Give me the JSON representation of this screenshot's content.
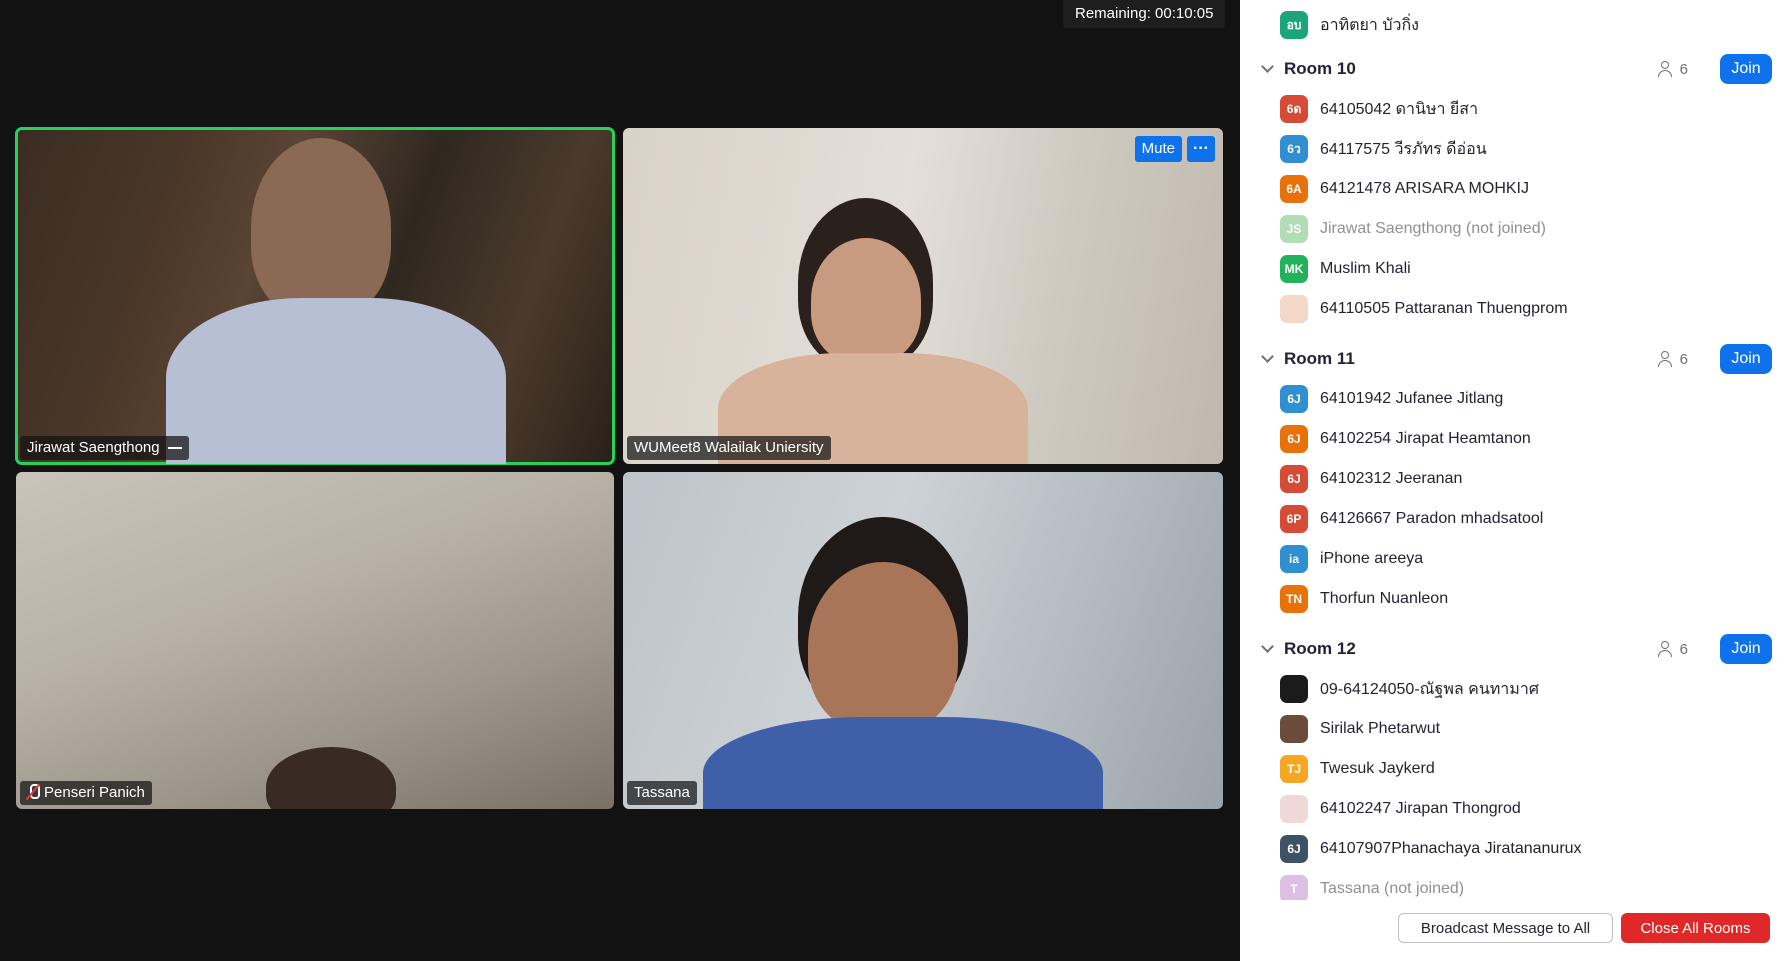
{
  "meeting": {
    "remaining": "Remaining: 00:10:05"
  },
  "videos": [
    {
      "name": "Jirawat Saengthong",
      "speaking": true
    },
    {
      "name": "WUMeet8 Walailak Uniersity",
      "mute_label": "Mute",
      "more_label": "···"
    },
    {
      "name": "Penseri Panich",
      "muted": true
    },
    {
      "name": "Tassana"
    }
  ],
  "rooms_panel": {
    "top_partial": {
      "initials": "อบ",
      "name": "อาทิตยา บัวกิ่ง",
      "color": "#1aa57a"
    },
    "rooms": [
      {
        "title": "Room 10",
        "count": "6",
        "join_label": "Join",
        "participants": [
          {
            "initials": "6ด",
            "name": "64105042 ดานิษา ยีสา",
            "color": "#d64b35"
          },
          {
            "initials": "6ว",
            "name": "64117575 วีรภัทร ดีอ่อน",
            "color": "#2f8fd0"
          },
          {
            "initials": "6A",
            "name": "64121478 ARISARA MOHKIJ",
            "color": "#e8710a"
          },
          {
            "initials": "JS",
            "name": "Jirawat Saengthong (not joined)",
            "color": "#a5d6a7",
            "not_joined": true
          },
          {
            "initials": "MK",
            "name": "Muslim Khali",
            "color": "#22b35a"
          },
          {
            "initials": "",
            "name": "64110505 Pattaranan Thuengprom",
            "color": "#f4d8c7",
            "photo": true
          }
        ]
      },
      {
        "title": "Room 11",
        "count": "6",
        "join_label": "Join",
        "participants": [
          {
            "initials": "6J",
            "name": "64101942 Jufanee Jitlang",
            "color": "#2f8fd0"
          },
          {
            "initials": "6J",
            "name": "64102254 Jirapat  Heamtanon",
            "color": "#e8710a"
          },
          {
            "initials": "6J",
            "name": "64102312 Jeeranan",
            "color": "#d64b35"
          },
          {
            "initials": "6P",
            "name": "64126667 Paradon mhadsatool",
            "color": "#d64b35"
          },
          {
            "initials": "ia",
            "name": "iPhone areeya",
            "color": "#2f8fd0"
          },
          {
            "initials": "TN",
            "name": "Thorfun Nuanleon",
            "color": "#e8710a"
          }
        ]
      },
      {
        "title": "Room 12",
        "count": "6",
        "join_label": "Join",
        "participants": [
          {
            "initials": "",
            "name": "09-64124050-ณัฐพล คนทามาศ",
            "color": "#1b1b1b",
            "photo": true
          },
          {
            "initials": "",
            "name": "Sirilak Phetarwut",
            "color": "#6b4c3b",
            "photo": true
          },
          {
            "initials": "TJ",
            "name": "Twesuk Jaykerd",
            "color": "#f5a623"
          },
          {
            "initials": "",
            "name": "64102247 Jirapan Thongrod",
            "color": "#f0d8d8",
            "photo": true
          },
          {
            "initials": "6J",
            "name": "64107907Phanachaya Jiratananurux",
            "color": "#3d5266"
          },
          {
            "initials": "T",
            "name": "Tassana (not joined)",
            "color": "#d8b4e2",
            "not_joined": true
          }
        ]
      }
    ],
    "broadcast_label": "Broadcast Message to All",
    "close_all_label": "Close All Rooms"
  }
}
